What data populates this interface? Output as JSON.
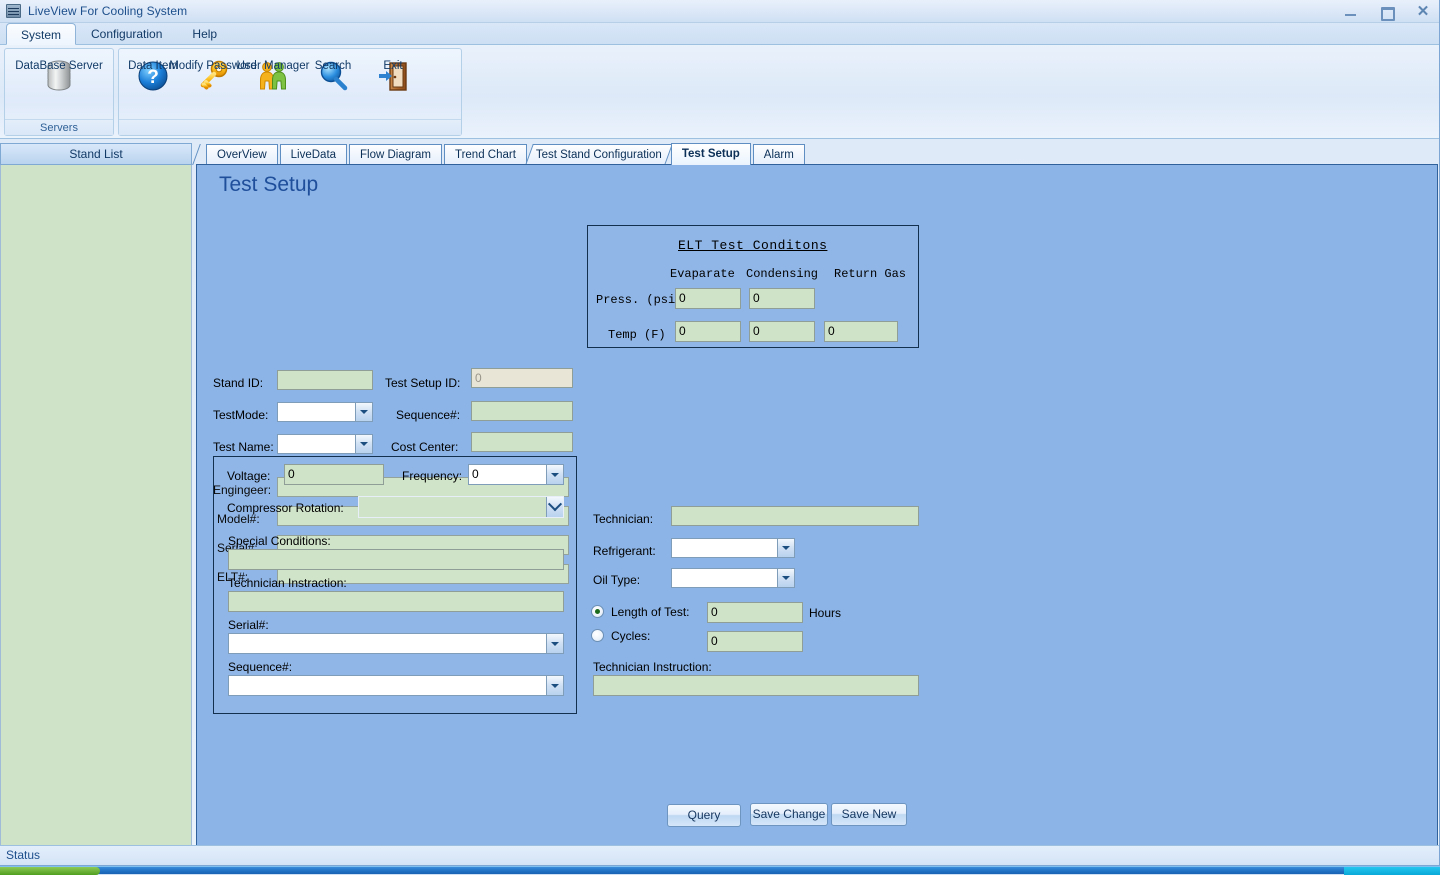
{
  "window": {
    "title": "LiveView For Cooling System",
    "icon": "monitor-icon",
    "minimize": "minimize-icon",
    "maximize": "maximize-icon",
    "close": "close-icon",
    "close_glyph": "✕"
  },
  "menu": {
    "tabs": [
      {
        "label": "System",
        "active": true
      },
      {
        "label": "Configuration",
        "active": false
      },
      {
        "label": "Help",
        "active": false
      }
    ]
  },
  "ribbon": {
    "groups": [
      {
        "name": "servers",
        "label": "Servers",
        "items": [
          {
            "label": "DataBase Server",
            "icon": "database-icon"
          }
        ]
      },
      {
        "name": "tools",
        "label": "",
        "items": [
          {
            "label": "Data Item",
            "icon": "help-circle-icon"
          },
          {
            "label": "Modify Password",
            "icon": "key-icon"
          },
          {
            "label": "User Manager",
            "icon": "users-icon"
          },
          {
            "label": "Search",
            "icon": "magnifier-icon"
          },
          {
            "label": "Exit",
            "icon": "exit-door-icon"
          }
        ]
      }
    ]
  },
  "sidebar": {
    "header": "Stand List",
    "items": []
  },
  "tabs": [
    {
      "label": "OverView",
      "active": false
    },
    {
      "label": "LiveData",
      "active": false
    },
    {
      "label": "Flow Diagram",
      "active": false
    },
    {
      "label": "Trend Chart",
      "active": false
    },
    {
      "label": "Test Stand Configuration",
      "active": false
    },
    {
      "label": "Test Setup",
      "active": true
    },
    {
      "label": "Alarm",
      "active": false
    }
  ],
  "page": {
    "title": "Test Setup",
    "fields": {
      "stand_id": {
        "label": "Stand ID:",
        "value": ""
      },
      "test_setup_id": {
        "label": "Test Setup ID:",
        "value": "0",
        "disabled": true
      },
      "test_mode": {
        "label": "TestMode:",
        "value": ""
      },
      "sequence_no": {
        "label": "Sequence#:",
        "value": ""
      },
      "test_name": {
        "label": "Test Name:",
        "value": ""
      },
      "cost_center": {
        "label": "Cost Center:",
        "value": ""
      },
      "engineer": {
        "label": "Engingeer:",
        "value": ""
      },
      "model_no": {
        "label": "Model#:",
        "value": ""
      },
      "serial_no": {
        "label": "Serial#:",
        "value": ""
      },
      "elt_no": {
        "label": "ELT#:",
        "value": ""
      },
      "technician": {
        "label": "Technician:",
        "value": ""
      },
      "refrigerant": {
        "label": "Refrigerant:",
        "value": ""
      },
      "oil_type": {
        "label": "Oil Type:",
        "value": ""
      },
      "technician_instruction_right": {
        "label": "Technician Instruction:",
        "value": ""
      }
    },
    "elt_conditions": {
      "title": "ELT Test Conditons",
      "columns": [
        "Evaparate",
        "Condensing",
        "Return Gas"
      ],
      "rows": [
        {
          "label": "Press. (psig)",
          "values": [
            "0",
            "0",
            null
          ]
        },
        {
          "label": "Temp (F)",
          "values": [
            "0",
            "0",
            "0"
          ]
        }
      ]
    },
    "test_length": {
      "length_label": "Length of Test:",
      "length_value": "0",
      "length_unit": "Hours",
      "length_selected": true,
      "cycles_label": "Cycles:",
      "cycles_value": "0",
      "cycles_selected": false
    },
    "electrical_group": {
      "voltage_label": "Voltage:",
      "voltage_value": "0",
      "frequency_label": "Frequency:",
      "frequency_value": "0",
      "compressor_rotation_label": "Compressor Rotation:",
      "compressor_rotation_value": "",
      "special_conditions_label": "Special Conditions:",
      "special_conditions_value": "",
      "technician_instruction_label": "Technician Instraction:",
      "technician_instruction_value": "",
      "serial_label": "Serial#:",
      "serial_value": "",
      "sequence_label": "Sequence#:",
      "sequence_value": ""
    },
    "buttons": {
      "query": "Query",
      "save_change": "Save Change",
      "save_new": "Save New"
    }
  },
  "status_bar": {
    "text": "Status"
  },
  "colors": {
    "panel_blue": "#8cb4e6",
    "field_green": "#cfe3c8",
    "title_blue": "#1f4e9b",
    "disabled_field": "#e9e5d6"
  }
}
